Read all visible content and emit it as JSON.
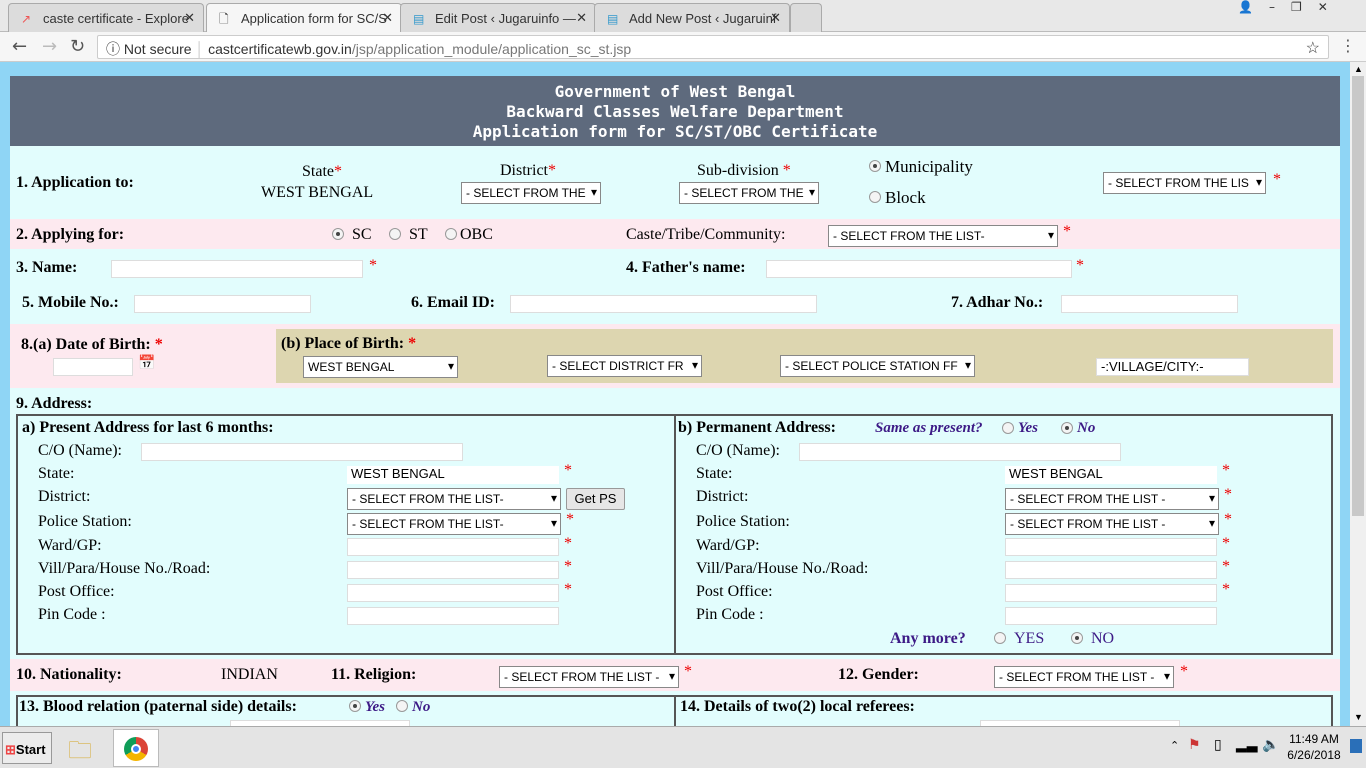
{
  "browser": {
    "tabs": [
      {
        "title": "caste certificate - Explore"
      },
      {
        "title": "Application form for SC/S"
      },
      {
        "title": "Edit Post ‹ Jugaruinfo — "
      },
      {
        "title": "Add New Post ‹ Jugaruinf"
      }
    ],
    "security": "Not secure",
    "url_host": "castcertificatewb.gov.in",
    "url_path": "/jsp/application_module/application_sc_st.jsp"
  },
  "header": {
    "line1": "Government of West Bengal",
    "line2": "Backward Classes Welfare Department",
    "line3": "Application form for SC/ST/OBC Certificate"
  },
  "s1": {
    "label": "1. Application to:",
    "state_label": "State",
    "state_value": "WEST BENGAL",
    "district_label": "District",
    "district_select": "- SELECT FROM THE",
    "subdiv_label": "Sub-division",
    "subdiv_select": "- SELECT FROM THE",
    "municipality": "Municipality",
    "block": "Block",
    "muni_select": "- SELECT FROM THE LIS"
  },
  "s2": {
    "label": "2. Applying for:",
    "sc": "SC",
    "st": "ST",
    "obc": "OBC",
    "caste_label": "Caste/Tribe/Community:",
    "caste_select": "- SELECT FROM THE LIST-"
  },
  "s3": {
    "name": "3. Name:",
    "father": "4. Father's name:",
    "mobile": "5. Mobile No.:",
    "email": "6. Email ID:",
    "adhar": "7. Adhar No.:"
  },
  "s8": {
    "dob": "8.(a) Date of Birth:",
    "pob": "(b) Place of Birth:",
    "state_select": "WEST BENGAL",
    "district_select": "- SELECT DISTRICT FR",
    "ps_select": "- SELECT POLICE STATION FF",
    "village": "-:VILLAGE/CITY:-"
  },
  "s9": {
    "label": "9. Address:",
    "present": {
      "title": "a) Present Address for last 6 months:",
      "co": "C/O (Name):",
      "state": "State:",
      "state_value": "WEST BENGAL",
      "district": "District:",
      "district_select": "- SELECT FROM THE LIST-",
      "get_ps": "Get PS",
      "ps": "Police Station:",
      "ps_select": "- SELECT FROM THE LIST-",
      "ward": "Ward/GP:",
      "vill": "Vill/Para/House No./Road:",
      "po": "Post Office:",
      "pin": "Pin Code :"
    },
    "permanent": {
      "title": "b) Permanent Address:",
      "same": "Same as present?",
      "yes": "Yes",
      "no": "No",
      "co": "C/O (Name):",
      "state": "State:",
      "state_value": "WEST BENGAL",
      "district": "District:",
      "district_select": "- SELECT FROM THE LIST -",
      "ps": "Police Station:",
      "ps_select": "- SELECT FROM THE LIST -",
      "ward": "Ward/GP:",
      "vill": "Vill/Para/House No./Road:",
      "po": "Post Office:",
      "pin": "Pin Code :",
      "any_more": "Any more?",
      "yes2": "YES",
      "no2": "NO"
    }
  },
  "s10": {
    "nationality": "10. Nationality:",
    "nationality_value": "INDIAN",
    "religion": "11. Religion:",
    "religion_select": "- SELECT FROM THE LIST -",
    "gender": "12. Gender:",
    "gender_select": "- SELECT FROM THE LIST -"
  },
  "s13": {
    "label": "13. Blood relation (paternal side) details:",
    "yes": "Yes",
    "no": "No",
    "referees": "14. Details of two(2) local referees:"
  },
  "taskbar": {
    "start": "Start",
    "time": "11:49 AM",
    "date": "6/26/2018"
  },
  "colors": {
    "header": "#5e6a7d",
    "form_bg": "#e2fdfd",
    "pink": "#fde9ef",
    "birth_bg": "#ddd6b0",
    "required": "#ee0000"
  }
}
